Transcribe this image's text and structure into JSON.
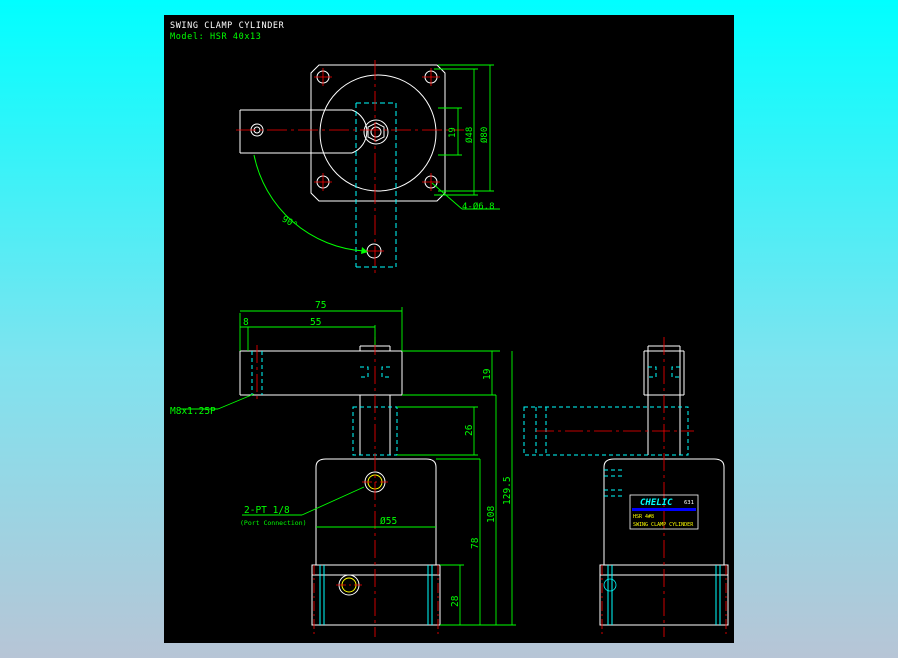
{
  "title": "SWING CLAMP CYLINDER",
  "model": "Model: HSR 40x13",
  "colors": {
    "background_gradient_top": "#00ffff",
    "background_gradient_bottom": "#b7c5d6",
    "canvas": "#000000",
    "outline": "#ffffff",
    "hidden": "#00ffff",
    "center": "#ff0000",
    "dimension": "#00ff00",
    "bore": "#ffff00",
    "label_bar": "#0000ff"
  },
  "top_view": {
    "dims": {
      "d48": "Ø48",
      "d80": "Ø80",
      "d19": "19",
      "holes": "4-Ø6.8",
      "angle": "90°"
    }
  },
  "front_view": {
    "dims": {
      "d75": "75",
      "d8": "8",
      "d55": "55",
      "d19": "19",
      "d26": "26",
      "d108": "108",
      "d129": "129.5",
      "d78": "78",
      "d28": "28",
      "dia55": "Ø55"
    },
    "thread_label": "M8x1.25P",
    "port_label": "2-PT 1/8",
    "port_sub": "(Port Connection)"
  },
  "side_view": {
    "nameplate": {
      "brand": "CHELIC",
      "code": "631",
      "model_text": "HSR 4#8",
      "product_text": "SWING CLAMP CYLINDER"
    }
  }
}
